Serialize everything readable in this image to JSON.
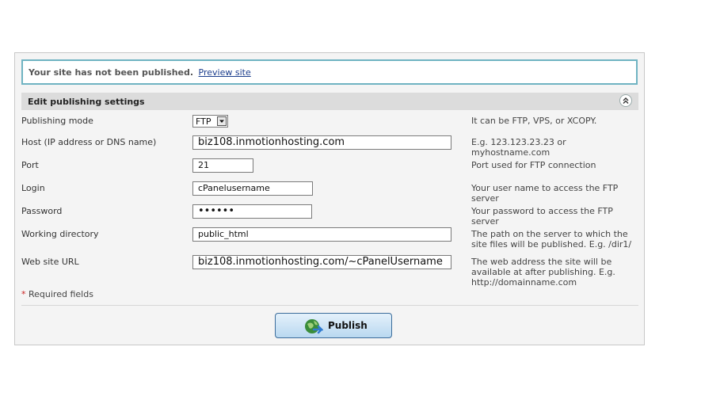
{
  "notice": {
    "message": "Your site has not been published.",
    "preview_link": "Preview site"
  },
  "section": {
    "title": "Edit publishing settings",
    "collapse_icon": "double-chevron-up-icon"
  },
  "fields": {
    "mode": {
      "label": "Publishing mode",
      "value": "FTP",
      "hint": "It can be FTP, VPS, or XCOPY."
    },
    "host": {
      "label": "Host (IP address or DNS name)",
      "value": "biz108.inmotionhosting.com",
      "hint": "E.g. 123.123.23.23 or myhostname.com"
    },
    "port": {
      "label": "Port",
      "value": "21",
      "hint": "Port used for FTP connection"
    },
    "login": {
      "label": "Login",
      "value": "cPanelusername",
      "hint": "Your user name to access the FTP server"
    },
    "password": {
      "label": "Password",
      "value": "••••••",
      "hint": "Your password to access the FTP server"
    },
    "workdir": {
      "label": "Working directory",
      "value": "public_html",
      "hint": "The path on the server to which the site files will be published. E.g. /dir1/"
    },
    "url": {
      "label": "Web site URL",
      "value": "biz108.inmotionhosting.com/~cPanelUsername",
      "hint": "The web address the site will be available at after publishing. E.g. http://domainname.com"
    }
  },
  "required": {
    "star": "*",
    "text": "Required fields"
  },
  "publish_button": {
    "label": "Publish",
    "icon": "globe-refresh-icon"
  },
  "colors": {
    "notice_border": "#6fb3c2",
    "section_bar": "#dcdcdc",
    "button_border": "#3b6c9a"
  }
}
